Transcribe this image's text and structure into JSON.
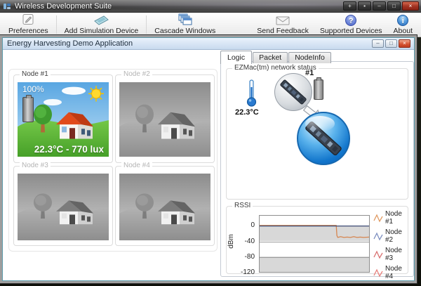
{
  "window": {
    "title": "Wireless Development Suite",
    "caption_buttons": {
      "move": "+",
      "dock": "▪",
      "minimize": "–",
      "maximize": "□",
      "close": "×"
    }
  },
  "toolbar": {
    "buttons_left": [
      {
        "label": "Preferences"
      },
      {
        "label": "Add Simulation Device"
      },
      {
        "label": "Cascade Windows"
      }
    ],
    "buttons_right": [
      {
        "label": "Send Feedback"
      },
      {
        "label": "Supported Devices"
      },
      {
        "label": "About"
      }
    ],
    "icon_glyphs": {
      "question": "?",
      "info": "i"
    }
  },
  "child_window": {
    "title": "Energy Harvesting Demo Application",
    "caption_buttons": {
      "minimize": "–",
      "maximize": "□",
      "close": "×"
    }
  },
  "nodes": [
    {
      "label": "Node #1",
      "active": true,
      "battery_percent": "100%",
      "status_text": "22.3°C - 770 lux"
    },
    {
      "label": "Node #2",
      "active": false
    },
    {
      "label": "Node #3",
      "active": false
    },
    {
      "label": "Node #4",
      "active": false
    }
  ],
  "right_panel": {
    "tabs": [
      {
        "label": "Logic",
        "selected": true
      },
      {
        "label": "Packet",
        "selected": false
      },
      {
        "label": "NodeInfo",
        "selected": false
      }
    ],
    "network_status": {
      "group_label": "EZMac(tm) network status",
      "temperature": "22.3°C",
      "node_badge": "#1"
    },
    "rssi_group_label": "RSSI"
  },
  "chart_data": {
    "type": "line",
    "title": "RSSI",
    "ylabel": "dBm",
    "ylim": [
      -120,
      25
    ],
    "yticks": [
      "0",
      "-40",
      "-80",
      "-120"
    ],
    "x_range": [
      0,
      100
    ],
    "grid": "horizontal-bands",
    "band_colors": {
      "stripe": "#d8d8d8",
      "background": "#ffffff"
    },
    "legend_position": "right",
    "series": [
      {
        "name": "Node #1",
        "color": "#d6854f",
        "points": [
          [
            0,
            0
          ],
          [
            70,
            0
          ],
          [
            70.6,
            -26
          ],
          [
            71.4,
            -31
          ],
          [
            74,
            -29
          ],
          [
            77,
            -31
          ],
          [
            80,
            -30
          ],
          [
            83,
            -31
          ],
          [
            86,
            -29
          ],
          [
            89,
            -31
          ],
          [
            92,
            -30
          ],
          [
            95,
            -31
          ],
          [
            100,
            -30
          ]
        ]
      },
      {
        "name": "Node #2",
        "color": "#3d4b75",
        "points": [
          [
            0,
            -1.5
          ],
          [
            100,
            -1.5
          ]
        ]
      },
      {
        "name": "Node #3",
        "color": "#d96a6a",
        "points": []
      },
      {
        "name": "Node #4",
        "color": "#e4807d",
        "points": []
      }
    ],
    "legend": [
      {
        "label": "Node #1",
        "color": "#e09a62"
      },
      {
        "label": "Node #2",
        "color": "#7d8fc0"
      },
      {
        "label": "Node #3",
        "color": "#d97070"
      },
      {
        "label": "Node #4",
        "color": "#e8807c"
      }
    ]
  }
}
